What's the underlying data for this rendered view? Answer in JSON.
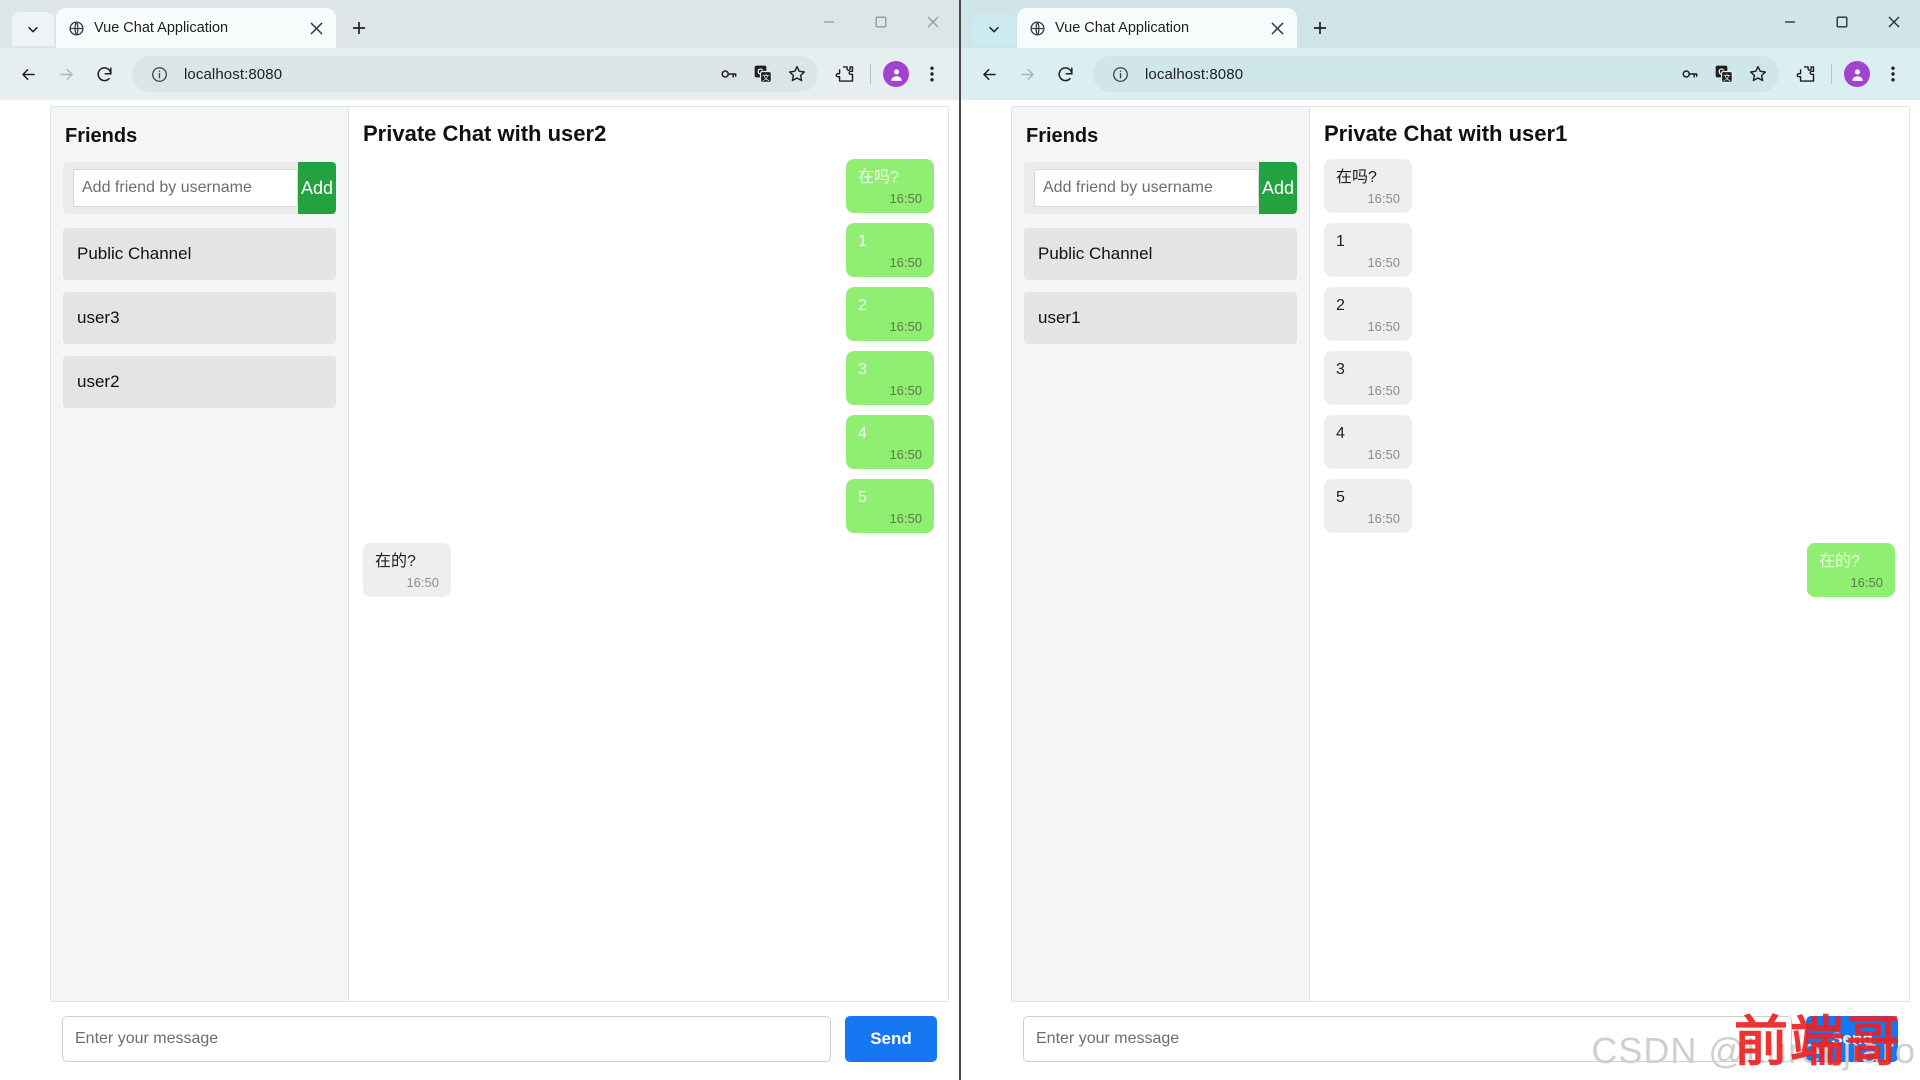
{
  "windows": [
    {
      "id": "left",
      "active": false,
      "tab": {
        "title": "Vue Chat Application",
        "favicon": "globe-icon",
        "close": "close-icon"
      },
      "newtab_label": "+",
      "tab_search_icon": "chevron-down-icon",
      "window_controls": {
        "minimize": "minimize-icon",
        "maximize": "maximize-icon",
        "close": "close-icon"
      },
      "toolbar": {
        "back": "back-arrow-icon",
        "forward": "forward-arrow-icon",
        "reload": "reload-icon",
        "site_info": "info-circle-icon",
        "url": "localhost:8080",
        "password_icon": "key-icon",
        "translate_icon": "translate-icon",
        "bookmark_icon": "star-icon",
        "extensions_icon": "puzzle-piece-icon",
        "profile_icon": "avatar-icon",
        "menu_icon": "three-dots-icon"
      },
      "app": {
        "sidebar": {
          "title": "Friends",
          "add_placeholder": "Add friend by username",
          "add_value": "",
          "add_button": "Add",
          "items": [
            {
              "label": "Public Channel"
            },
            {
              "label": "user3"
            },
            {
              "label": "user2"
            }
          ]
        },
        "chat": {
          "title": "Private Chat with user2",
          "messages": [
            {
              "dir": "out",
              "text": "在吗?",
              "time": "16:50"
            },
            {
              "dir": "out",
              "text": "1",
              "time": "16:50"
            },
            {
              "dir": "out",
              "text": "2",
              "time": "16:50"
            },
            {
              "dir": "out",
              "text": "3",
              "time": "16:50"
            },
            {
              "dir": "out",
              "text": "4",
              "time": "16:50"
            },
            {
              "dir": "out",
              "text": "5",
              "time": "16:50"
            },
            {
              "dir": "in",
              "text": "在的?",
              "time": "16:50"
            }
          ],
          "input_placeholder": "Enter your message",
          "input_value": "",
          "send_button": "Send"
        }
      },
      "watermark": null
    },
    {
      "id": "right",
      "active": true,
      "tab": {
        "title": "Vue Chat Application",
        "favicon": "globe-icon",
        "close": "close-icon"
      },
      "newtab_label": "+",
      "tab_search_icon": "chevron-down-icon",
      "window_controls": {
        "minimize": "minimize-icon",
        "maximize": "maximize-icon",
        "close": "close-icon"
      },
      "toolbar": {
        "back": "back-arrow-icon",
        "forward": "forward-arrow-icon",
        "reload": "reload-icon",
        "site_info": "info-circle-icon",
        "url": "localhost:8080",
        "password_icon": "key-icon",
        "translate_icon": "translate-icon",
        "bookmark_icon": "star-icon",
        "extensions_icon": "puzzle-piece-icon",
        "profile_icon": "avatar-icon",
        "menu_icon": "three-dots-icon"
      },
      "app": {
        "sidebar": {
          "title": "Friends",
          "add_placeholder": "Add friend by username",
          "add_value": "",
          "add_button": "Add",
          "items": [
            {
              "label": "Public Channel"
            },
            {
              "label": "user1"
            }
          ]
        },
        "chat": {
          "title": "Private Chat with user1",
          "messages": [
            {
              "dir": "in",
              "text": "在吗?",
              "time": "16:50"
            },
            {
              "dir": "in",
              "text": "1",
              "time": "16:50"
            },
            {
              "dir": "in",
              "text": "2",
              "time": "16:50"
            },
            {
              "dir": "in",
              "text": "3",
              "time": "16:50"
            },
            {
              "dir": "in",
              "text": "4",
              "time": "16:50"
            },
            {
              "dir": "in",
              "text": "5",
              "time": "16:50"
            },
            {
              "dir": "out",
              "text": "在的?",
              "time": "16:50"
            }
          ],
          "input_placeholder": "Enter your message",
          "input_value": "",
          "send_button": "Send"
        }
      },
      "watermark": {
        "gray_text": "CSDN @Lurenjiaro",
        "red_text": "前端哥"
      }
    }
  ],
  "colors": {
    "accent_send": "#1577f2",
    "accent_add": "#22a33f",
    "bubble_out": "#90ee72",
    "bubble_in": "#eeeeee",
    "watermark_red": "#ee2222"
  }
}
